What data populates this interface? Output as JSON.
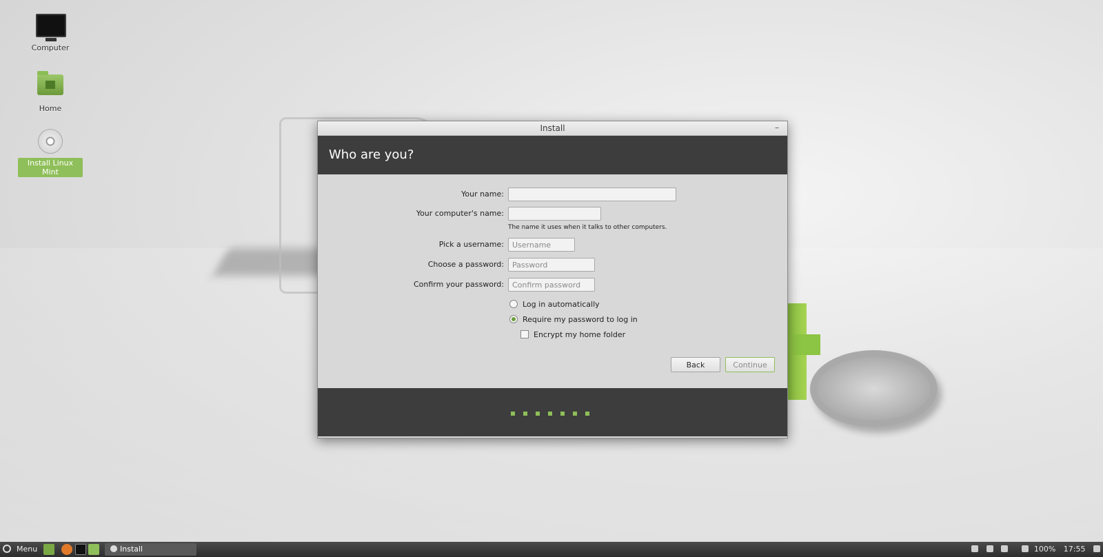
{
  "desktop": {
    "icons": [
      {
        "label": "Computer",
        "icon": "computer-icon"
      },
      {
        "label": "Home",
        "icon": "home-folder-icon"
      },
      {
        "label": "Install Linux Mint",
        "icon": "disc-icon"
      }
    ]
  },
  "window": {
    "title": "Install",
    "header": "Who are you?",
    "form": {
      "your_name_label": "Your name:",
      "your_name_value": "",
      "computer_name_label": "Your computer's name:",
      "computer_name_value": "",
      "computer_name_hint": "The name it uses when it talks to other computers.",
      "username_label": "Pick a username:",
      "username_placeholder": "Username",
      "password_label": "Choose a password:",
      "password_placeholder": "Password",
      "confirm_label": "Confirm your password:",
      "confirm_placeholder": "Confirm password",
      "login_auto": "Log in automatically",
      "login_require": "Require my password to log in",
      "encrypt_home": "Encrypt my home folder",
      "selected_login": "require"
    },
    "buttons": {
      "back": "Back",
      "continue": "Continue"
    },
    "progress": {
      "steps": 7,
      "accent": "#8fbf5a"
    }
  },
  "taskbar": {
    "menu_label": "Menu",
    "task_label": "Install",
    "battery": "100%",
    "clock": "17:55"
  }
}
